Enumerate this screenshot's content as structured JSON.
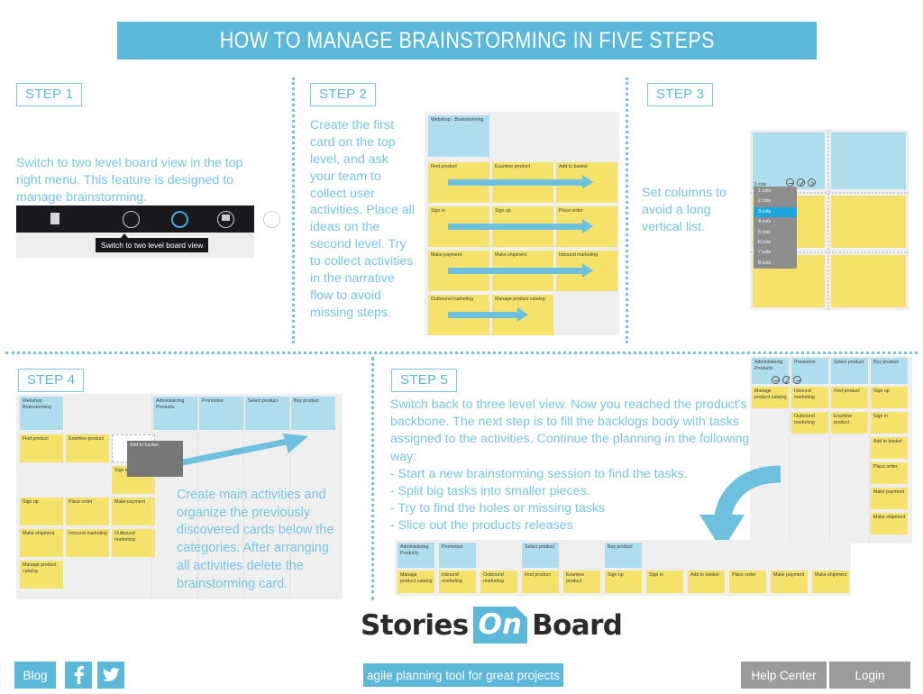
{
  "header": {
    "title": "HOW TO MANAGE BRAINSTORMING IN FIVE STEPS"
  },
  "colors": {
    "accent_blue": "#5cb8d9",
    "text_blue": "#76c5e0",
    "card_blue": "#aeddee",
    "card_yellow": "#f4e26a",
    "board_bg": "#efefef",
    "gray_button": "#9b9b9b",
    "drag_card_gray": "#777777"
  },
  "steps": [
    {
      "badge": "STEP 1",
      "text": "Switch to two level board view in the top right menu. This feature is designed to manage brainstorming.",
      "screenshot": {
        "tooltip": "Switch to two level board view"
      }
    },
    {
      "badge": "STEP 2",
      "text": "Create the first card on the top level, and ask your team to collect user activities. Place all ideas on the second level. Try to collect activities in the narrative flow to avoid missing steps.",
      "board": {
        "top_card": "Webshop - Brainstorming",
        "rows": [
          [
            "Find product",
            "Examine product",
            "Add to basket"
          ],
          [
            "Sign in",
            "Sign up",
            "Place order"
          ],
          [
            "Make payment",
            "Make shipment",
            "Inbound marketing"
          ],
          [
            "Outbound marketing",
            "Manage product catalog"
          ]
        ]
      }
    },
    {
      "badge": "STEP 3",
      "text": "Set columns to avoid a long vertical list.",
      "widget": {
        "cols_label": "1 cols",
        "dropdown_options": [
          "1 cols",
          "2 cols",
          "3 cols",
          "4 cols",
          "5 cols",
          "6 cols",
          "7 cols",
          "8 cols"
        ],
        "dropdown_selected": "3 cols",
        "toolbar_icons": [
          "minus-circle-icon",
          "slash-circle-icon",
          "chevron-right-circle-icon"
        ]
      }
    },
    {
      "badge": "STEP 4",
      "text": "Create main activities and organize the previously discovered cards below the categories. After arranging all activities delete the brainstorming card.",
      "board": {
        "left_top_card": "Webshop - Brainstorming",
        "category_cards": [
          "Administering Products",
          "Promotion",
          "Select product",
          "Buy product"
        ],
        "row1": [
          "Find product",
          "Examine product"
        ],
        "ghost_card": "",
        "dragging_card": "Add to basket",
        "row2": [
          "Sign in"
        ],
        "row3": [
          "Sign up",
          "Place order",
          "Make payment"
        ],
        "row4": [
          "Make shipment",
          "Inbound marketing",
          "Outbound marketing"
        ],
        "row5": [
          "Manage product catalog"
        ]
      }
    },
    {
      "badge": "STEP 5",
      "text_lines": [
        "Switch back to three level view. Now you reached the product's",
        "backbone. The next step is to fill the backlogs body with tasks",
        "assigned to the activities. Continue the planning in the following",
        "way:",
        "- Start a new brainstorming session to find the tasks.",
        "- Split big tasks into smaller pieces.",
        "- Try to find the holes or missing tasks",
        "- Slice out the products releases"
      ],
      "vertical_board": {
        "headers": [
          "Administering Products",
          "Promotion",
          "Select product",
          "Buy product"
        ],
        "columns": [
          [
            "Manage product catalog"
          ],
          [
            "Inbound marketing",
            "Outbound marketing"
          ],
          [
            "Find product",
            "Examine product"
          ],
          [
            "Sign up",
            "Sign in",
            "Add to basket",
            "Place order",
            "Make payment",
            "Make shipment"
          ]
        ]
      },
      "horizontal_board": {
        "headers": [
          "Administering Products",
          "Promotion",
          "",
          "Select product",
          "",
          "Buy product",
          "",
          "",
          "",
          "",
          "",
          ""
        ],
        "cards": [
          "Manage product catalog",
          "Inbound marketing",
          "Outbound marketing",
          "Find product",
          "Examine product",
          "Sign up",
          "Sign in",
          "Add to basket",
          "Place order",
          "Make payment",
          "Make shipment"
        ]
      }
    }
  ],
  "logo": {
    "part1": "Stories",
    "part2": "On",
    "part3": "Board"
  },
  "footer": {
    "blog_label": "Blog",
    "facebook_icon": "facebook-icon",
    "twitter_icon": "twitter-icon",
    "tagline": "agile planning tool for great projects",
    "help_label": "Help Center",
    "login_label": "Login"
  }
}
